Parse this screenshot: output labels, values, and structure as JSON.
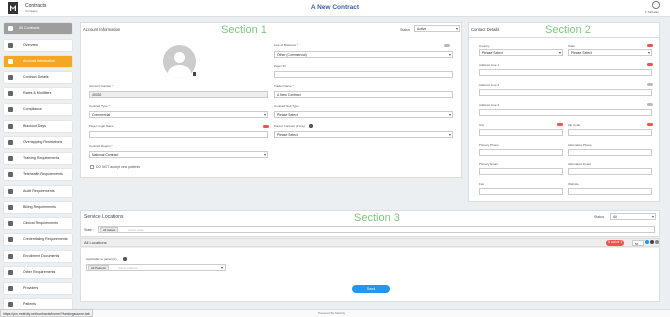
{
  "header": {
    "brand_title": "Contracts",
    "brand_subtitle": "Company",
    "page_title": "A New Contract",
    "user_label": "T. McLean"
  },
  "sidebar": {
    "all_contracts": "All Contracts",
    "items": [
      {
        "label": "Overview"
      },
      {
        "label": "Account Information"
      },
      {
        "label": "Contract Details"
      },
      {
        "label": "Rates & Modifiers"
      },
      {
        "label": "Compliance"
      },
      {
        "label": "Blackout Days"
      },
      {
        "label": "Overlapping Restrictions"
      },
      {
        "label": "Training Requirements"
      },
      {
        "label": "Telehealth Requirements"
      },
      {
        "label": "Audit Requirements"
      },
      {
        "label": "Billing Requirements"
      },
      {
        "label": "Clinical Requirements"
      },
      {
        "label": "Credentialing Requirements"
      },
      {
        "label": "Enrollment Documents"
      },
      {
        "label": "Other Requirements"
      },
      {
        "label": "Providers"
      },
      {
        "label": "Patients"
      }
    ]
  },
  "account_info": {
    "title": "Account Information",
    "section_label": "Section 1",
    "status_label": "Status",
    "status_value": "Active",
    "line_of_business_label": "Line of Business",
    "line_of_business_value": "Other (Commercial)",
    "payer_id_label": "Payer ID",
    "account_number_label": "Account Number",
    "account_number_value": "40032",
    "contract_type_label": "Contract Type",
    "contract_type_value": "Commercial",
    "payer_legal_name_label": "Payer Legal Name",
    "contract_region_label": "Contract Region",
    "contract_region_value": "National Contract",
    "do_not_accept_label": "DO NOT accept new patients",
    "trade_name_label": "Trader Name",
    "trade_name_value": "A New Contract",
    "contract_sub_type_label": "Contract Sub Type",
    "contract_sub_type_value": "Please Select",
    "parent_contract_label": "Parent Contract (if any)",
    "parent_contract_value": "Please Select"
  },
  "contact_details": {
    "title": "Contact Details",
    "section_label": "Section 2",
    "country_label": "Country",
    "country_value": "Please Select",
    "state_label": "State",
    "state_value": "Please Select",
    "address1_label": "Address Line 1",
    "address2_label": "Address Line 2",
    "address3_label": "Address Line 3",
    "city_label": "City",
    "zip_label": "Zip Code",
    "primary_phone_label": "Primary Phone",
    "alt_phone_label": "Alternative Phone",
    "primary_email_label": "Primary Email",
    "alt_email_label": "Alternative Email",
    "fax_label": "Fax",
    "website_label": "Website"
  },
  "service_locations": {
    "title": "Service Locations",
    "section_label": "Section 3",
    "status_label": "Status",
    "status_value": "All",
    "state_label": "State",
    "state_tag": "All states",
    "state_placeholder": "Select state",
    "all_locations_title": "All Locations",
    "count_badge": "0 out of 1",
    "per_page_value": "50",
    "applicable_label": "Applicable to patient(s)",
    "patients_tag": "All Patients",
    "patients_placeholder": "Select patients"
  },
  "actions": {
    "send_label": "Send"
  },
  "footer": {
    "status_url": "https://pm.motivity.net/contracts/home/?fundingsource-tab",
    "powered_by": "Powered By  Motivity"
  },
  "colors": {
    "accent_active": "#f5a623",
    "title_blue": "#3a5fa3",
    "section_green": "#7ec87e",
    "send_blue": "#2196f3",
    "required_red": "#ef5350"
  }
}
